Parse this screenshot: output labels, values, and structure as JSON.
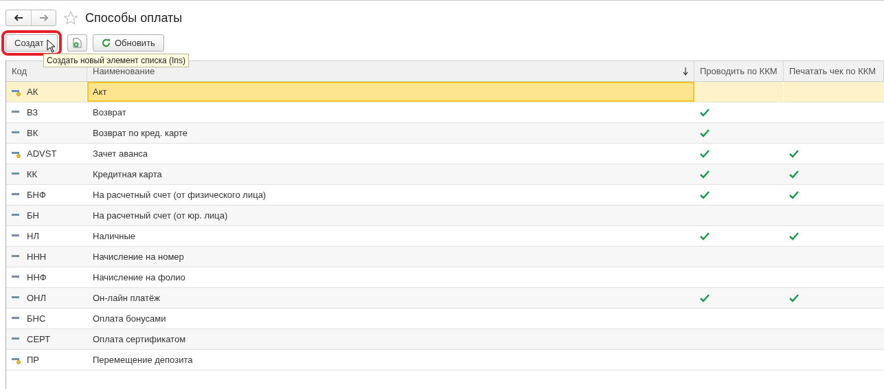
{
  "window": {
    "title": "Способы оплаты",
    "favorite": false
  },
  "toolbar": {
    "create_button": {
      "label": "Создат",
      "highlighted": true
    },
    "refresh_button": {
      "label": "Обновить"
    }
  },
  "tooltip": {
    "text": "Создать новый элемент списка (Ins)"
  },
  "table": {
    "columns": [
      {
        "label": "Код"
      },
      {
        "label": "Наименование",
        "sorted": true
      },
      {
        "label": "Проводить по ККМ"
      },
      {
        "label": "Печатать чек по ККМ"
      }
    ],
    "rows": [
      {
        "code": "АК",
        "name": "Акт",
        "predefined": true,
        "ccm": false,
        "print": false,
        "selected": true
      },
      {
        "code": "ВЗ",
        "name": "Возврат",
        "predefined": false,
        "ccm": true,
        "print": false,
        "selected": false
      },
      {
        "code": "ВК",
        "name": "Возврат по кред. карте",
        "predefined": false,
        "ccm": true,
        "print": false,
        "selected": false
      },
      {
        "code": "ADVST",
        "name": "Зачет аванса",
        "predefined": true,
        "ccm": true,
        "print": true,
        "selected": false
      },
      {
        "code": "КК",
        "name": "Кредитная карта",
        "predefined": false,
        "ccm": true,
        "print": true,
        "selected": false
      },
      {
        "code": "БНФ",
        "name": "На расчетный счет (от физического лица)",
        "predefined": false,
        "ccm": true,
        "print": true,
        "selected": false
      },
      {
        "code": "БН",
        "name": "На расчетный счет (от юр. лица)",
        "predefined": false,
        "ccm": false,
        "print": false,
        "selected": false
      },
      {
        "code": "НЛ",
        "name": "Наличные",
        "predefined": false,
        "ccm": true,
        "print": true,
        "selected": false
      },
      {
        "code": "ННН",
        "name": "Начисление на номер",
        "predefined": false,
        "ccm": false,
        "print": false,
        "selected": false
      },
      {
        "code": "ННФ",
        "name": "Начисление на фолио",
        "predefined": false,
        "ccm": false,
        "print": false,
        "selected": false
      },
      {
        "code": "ОНЛ",
        "name": "Он-лайн платёж",
        "predefined": false,
        "ccm": true,
        "print": true,
        "selected": false
      },
      {
        "code": "БНС",
        "name": "Оплата бонусами",
        "predefined": false,
        "ccm": false,
        "print": false,
        "selected": false
      },
      {
        "code": "СЕРТ",
        "name": "Оплата сертификатом",
        "predefined": false,
        "ccm": false,
        "print": false,
        "selected": false
      },
      {
        "code": "ПР",
        "name": "Перемещение депозита",
        "predefined": true,
        "ccm": false,
        "print": false,
        "selected": false
      }
    ]
  }
}
